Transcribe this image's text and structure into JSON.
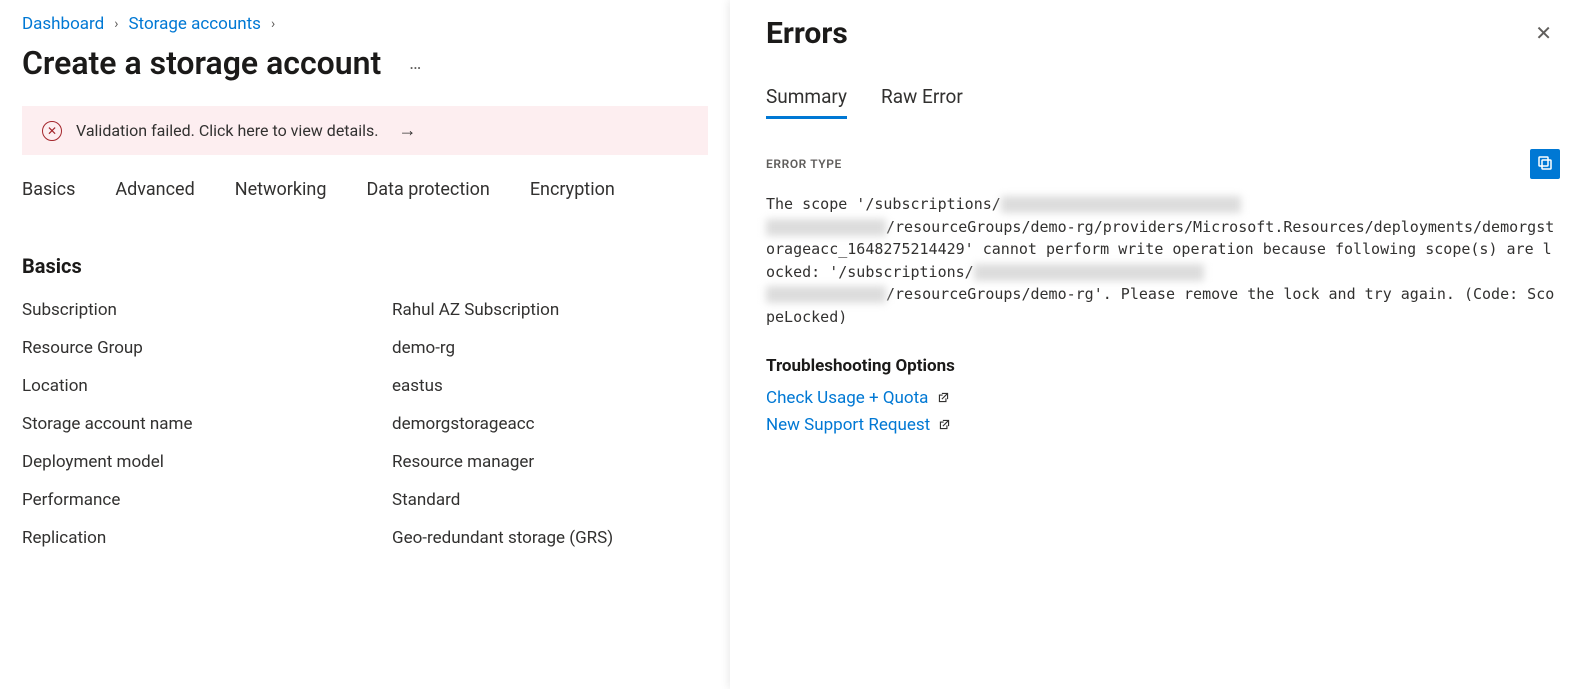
{
  "breadcrumb": {
    "items": [
      "Dashboard",
      "Storage accounts"
    ]
  },
  "page_title": "Create a storage account",
  "validation_banner": {
    "message": "Validation failed. Click here to view details."
  },
  "tabs": [
    "Basics",
    "Advanced",
    "Networking",
    "Data protection",
    "Encryption"
  ],
  "section": {
    "heading": "Basics",
    "rows": [
      {
        "k": "Subscription",
        "v": "Rahul AZ Subscription"
      },
      {
        "k": "Resource Group",
        "v": "demo-rg"
      },
      {
        "k": "Location",
        "v": "eastus"
      },
      {
        "k": "Storage account name",
        "v": "demorgstorageacc"
      },
      {
        "k": "Deployment model",
        "v": "Resource manager"
      },
      {
        "k": "Performance",
        "v": "Standard"
      },
      {
        "k": "Replication",
        "v": "Geo-redundant storage (GRS)"
      }
    ]
  },
  "errors_panel": {
    "title": "Errors",
    "tabs": {
      "summary": "Summary",
      "raw": "Raw Error"
    },
    "error_type_label": "ERROR TYPE",
    "error_text": {
      "p1": "The scope '/subscriptions/",
      "p2": "/resourceGroups/demo-rg/providers/Microsoft.Resources/deployments/demorgstorageacc_1648275214429' cannot perform write operation because following scope(s) are locked: '/subscriptions/",
      "p3": "/resourceGroups/demo-rg'. Please remove the lock and try again. (Code: ScopeLocked)"
    },
    "troubleshoot_heading": "Troubleshooting Options",
    "links": {
      "usage": "Check Usage + Quota",
      "support": "New Support Request"
    }
  }
}
